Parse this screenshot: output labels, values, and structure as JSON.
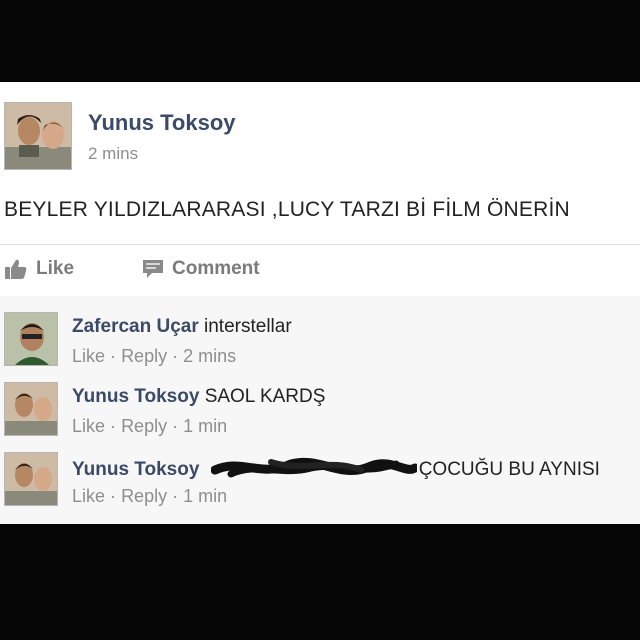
{
  "post": {
    "author": "Yunus Toksoy",
    "time": "2 mins",
    "text": "BEYLER YILDIZLARARASI ,LUCY TARZI Bİ FİLM ÖNERİN",
    "actions": {
      "like": "Like",
      "comment": "Comment"
    }
  },
  "comments": [
    {
      "author": "Zafercan Uçar",
      "text": "interstellar",
      "like": "Like",
      "reply": "Reply",
      "time": "2 mins",
      "sep": "·"
    },
    {
      "author": "Yunus Toksoy",
      "text": "SAOL KARDŞ",
      "like": "Like",
      "reply": "Reply",
      "time": "1 min",
      "sep": "·"
    },
    {
      "author": "Yunus Toksoy",
      "text": "ÇOCUĞU BU AYNISI",
      "like": "Like",
      "reply": "Reply",
      "time": "1 min",
      "sep": "·"
    }
  ],
  "icons": {
    "like": "thumbs-up-icon",
    "comment": "comment-icon"
  },
  "colors": {
    "name": "#3b4a66",
    "meta": "#8e8e8e",
    "background": "#050505"
  }
}
